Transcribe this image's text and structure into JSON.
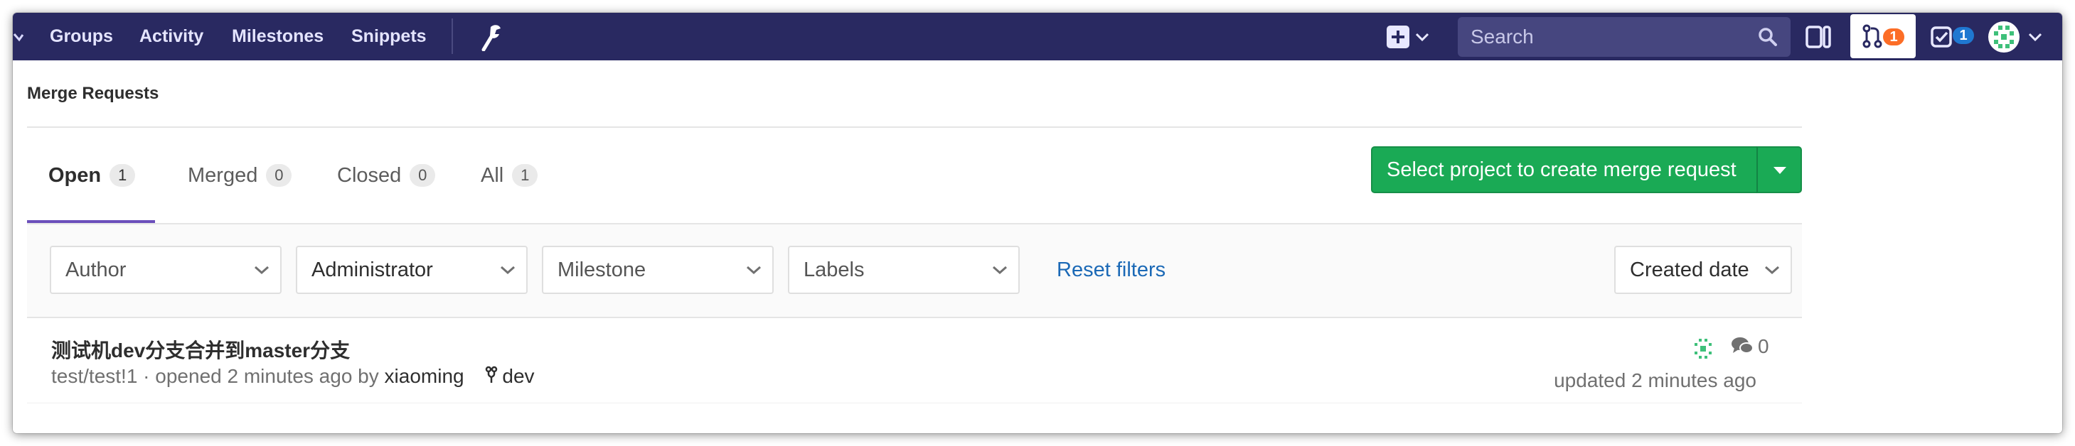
{
  "navbar": {
    "links": {
      "groups": "Groups",
      "activity": "Activity",
      "milestones": "Milestones",
      "snippets": "Snippets"
    },
    "search_placeholder": "Search",
    "merge_requests_count": "1",
    "todos_count": "1",
    "colors": {
      "background": "#292961",
      "mr_badge": "#fc6d26",
      "todo_badge": "#1f78d1"
    }
  },
  "breadcrumb": {
    "title": "Merge Requests"
  },
  "tabs": [
    {
      "label": "Open",
      "count": "1",
      "active": true
    },
    {
      "label": "Merged",
      "count": "0",
      "active": false
    },
    {
      "label": "Closed",
      "count": "0",
      "active": false
    },
    {
      "label": "All",
      "count": "1",
      "active": false
    }
  ],
  "create_button": {
    "label": "Select project to create merge request",
    "color": "#1aaa55"
  },
  "filters": {
    "author": "Author",
    "assignee": "Administrator",
    "milestone": "Milestone",
    "labels": "Labels",
    "reset": "Reset filters",
    "sort": "Created date"
  },
  "merge_requests": [
    {
      "title": "测试机dev分支合并到master分支",
      "reference": "test/test!1",
      "opened_text": " · opened 2 minutes ago by ",
      "author": "xiaoming",
      "branch": "dev",
      "comments": "0",
      "updated": "updated 2 minutes ago"
    }
  ],
  "icons": {
    "create_new": "plus-square-icon",
    "admin": "wrench-icon",
    "search": "search-icon",
    "sidebar": "sidebar-toggle-icon",
    "merge_request": "git-merge-request-icon",
    "todo": "todo-check-icon",
    "pipeline": "pipeline-status-icon",
    "comments": "comments-icon",
    "branch": "branch-icon"
  }
}
